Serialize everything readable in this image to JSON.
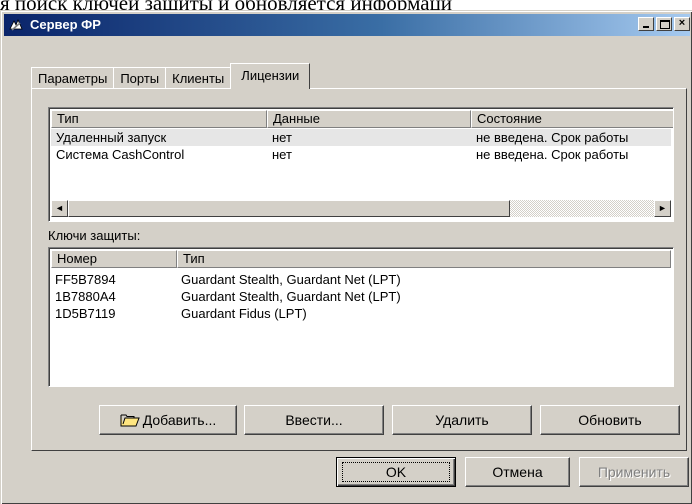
{
  "document_fragment": "я поиск ключей защиты и обновляется информаци",
  "window": {
    "title": "Сервер ФР",
    "close_glyph": "×"
  },
  "tabs": [
    {
      "label": "Параметры"
    },
    {
      "label": "Порты"
    },
    {
      "label": "Клиенты"
    },
    {
      "label": "Лицензии"
    }
  ],
  "licenses": {
    "columns": [
      "Тип",
      "Данные",
      "Состояние"
    ],
    "rows": [
      {
        "type": "Удаленный запуск",
        "data": "нет",
        "state": "не введена. Срок работы"
      },
      {
        "type": "Система CashControl",
        "data": "нет",
        "state": "не введена. Срок работы"
      }
    ],
    "scroll_left": "◄",
    "scroll_right": "►"
  },
  "keys": {
    "label": "Ключи защиты:",
    "columns": [
      "Номер",
      "Тип"
    ],
    "rows": [
      {
        "number": "FF5B7894",
        "type": "Guardant Stealth, Guardant Net (LPT)"
      },
      {
        "number": "1B7880A4",
        "type": "Guardant Stealth, Guardant Net (LPT)"
      },
      {
        "number": "1D5B7119",
        "type": "Guardant Fidus (LPT)"
      }
    ]
  },
  "panel_buttons": {
    "add": "Добавить...",
    "enter": "Ввести...",
    "delete": "Удалить",
    "refresh": "Обновить"
  },
  "dialog_buttons": {
    "ok": "OK",
    "cancel": "Отмена",
    "apply": "Применить"
  }
}
